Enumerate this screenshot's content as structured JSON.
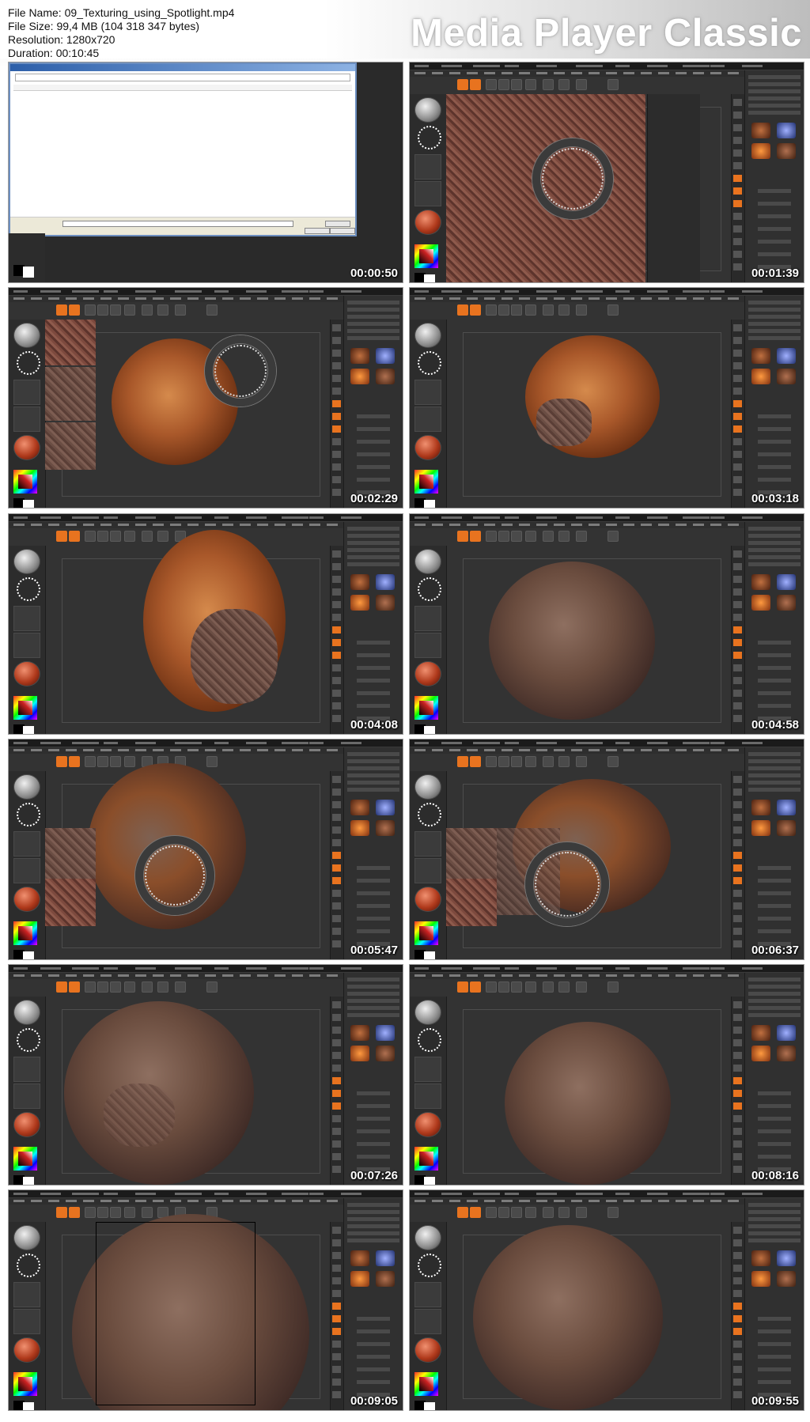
{
  "header": {
    "file_name": "File Name: 09_Texturing_using_Spotlight.mp4",
    "file_size": "File Size: 99,4 MB (104 318 347 bytes)",
    "resolution": "Resolution: 1280x720",
    "duration": "Duration: 00:10:45",
    "brand": "Media Player Classic"
  },
  "thumbnails": [
    {
      "time": "00:00:50",
      "scene": "file-dialog"
    },
    {
      "time": "00:01:39",
      "scene": "spotlight-texture"
    },
    {
      "time": "00:02:29",
      "scene": "orange-rock-spotlight"
    },
    {
      "time": "00:03:18",
      "scene": "orange-rock-painted"
    },
    {
      "time": "00:04:08",
      "scene": "orange-rock-rotated"
    },
    {
      "time": "00:04:58",
      "scene": "brown-rock"
    },
    {
      "time": "00:05:47",
      "scene": "rock-spotlight-patches"
    },
    {
      "time": "00:06:37",
      "scene": "rock-spotlight-patches-2"
    },
    {
      "time": "00:07:26",
      "scene": "textured-rock"
    },
    {
      "time": "00:08:16",
      "scene": "textured-rock-2"
    },
    {
      "time": "00:09:05",
      "scene": "textured-rock-closeup"
    },
    {
      "time": "00:09:55",
      "scene": "textured-rock-3"
    }
  ]
}
